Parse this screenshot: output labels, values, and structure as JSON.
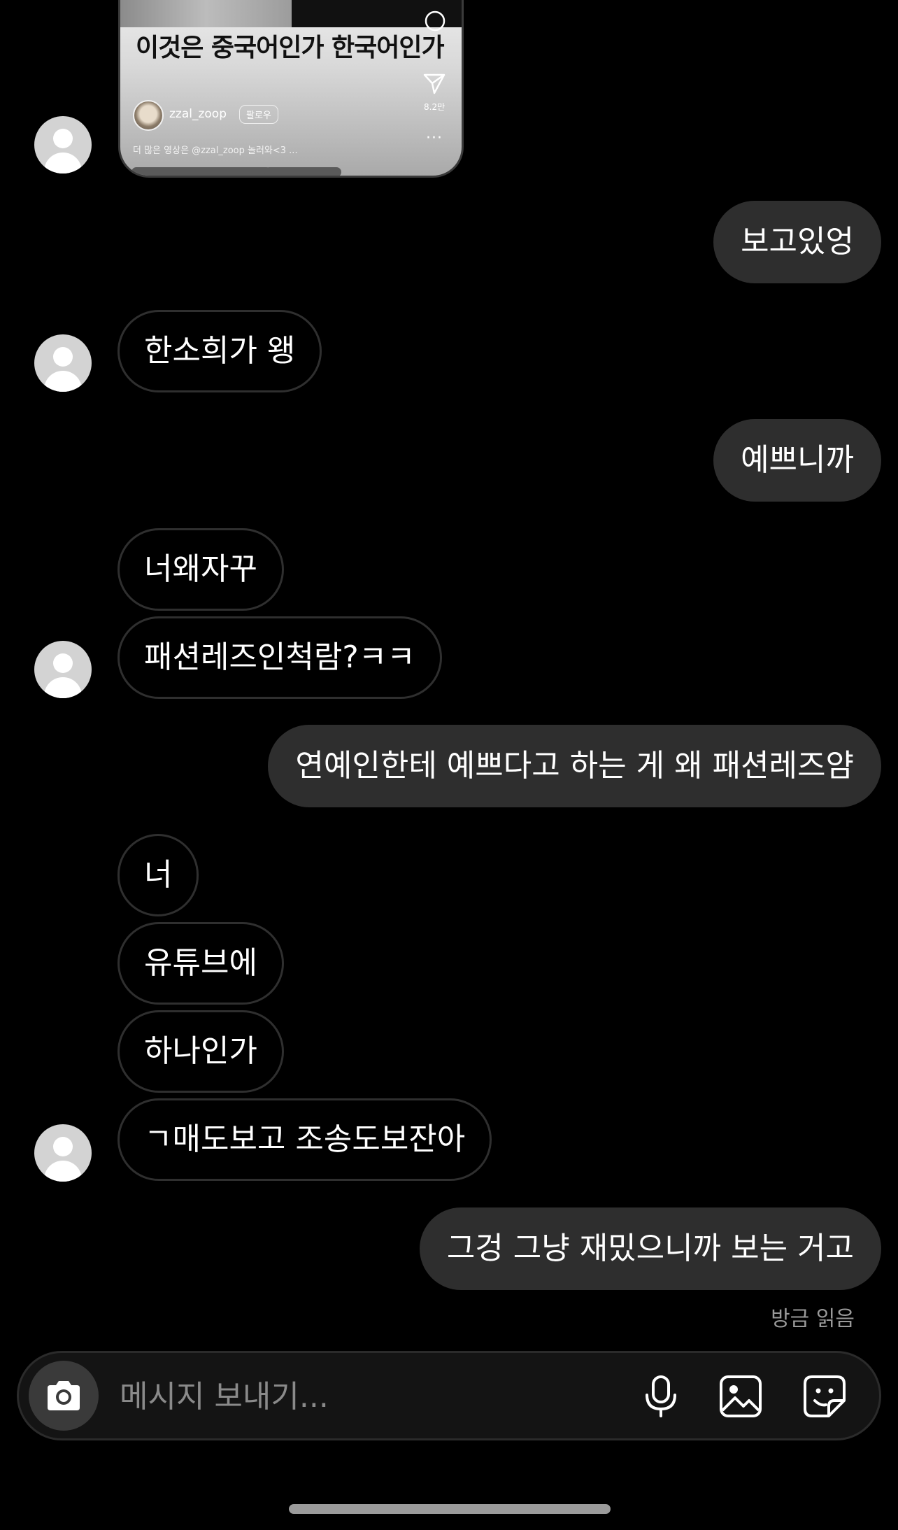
{
  "shared_post": {
    "title": "이것은 중국어인가 한국어인가",
    "username": "zzal_zoop",
    "follow_label": "팔로우",
    "caption": "더 많은 영상은 @zzal_zoop 놀러와<3 ...",
    "share_count": "8.2만"
  },
  "messages": [
    {
      "side": "out",
      "text": "보고있엉"
    },
    {
      "side": "in",
      "text": "한소희가 왱"
    },
    {
      "side": "out",
      "text": "예쁘니까"
    },
    {
      "side": "in",
      "text": "너왜자꾸"
    },
    {
      "side": "in",
      "text": "패션레즈인척람?ㅋㅋ"
    },
    {
      "side": "out",
      "text": "연예인한테 예쁘다고 하는 게 왜 패션레즈얌"
    },
    {
      "side": "in",
      "text": "너"
    },
    {
      "side": "in",
      "text": "유튜브에"
    },
    {
      "side": "in",
      "text": "하나인가"
    },
    {
      "side": "in",
      "text": "ㄱ매도보고 조송도보잔아"
    },
    {
      "side": "out",
      "text": "그겅 그냥 재밌으니까 보는 거고"
    }
  ],
  "read_status": "방금 읽음",
  "composer": {
    "placeholder": "메시지 보내기..."
  },
  "icons": {
    "camera": "camera-icon",
    "mic": "microphone-icon",
    "gallery": "image-gallery-icon",
    "sticker": "sticker-icon"
  }
}
